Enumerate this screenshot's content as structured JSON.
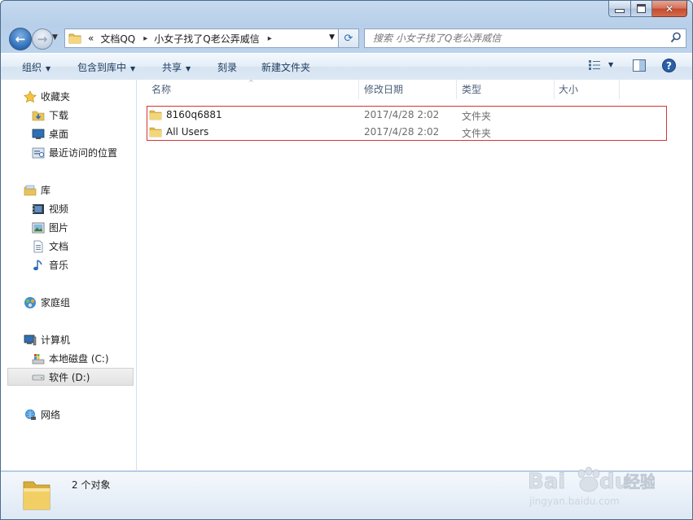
{
  "window": {
    "caption_buttons": {
      "close": "✕"
    }
  },
  "address": {
    "crumbs": [
      "«",
      "文档QQ",
      "小女子找了Q老公弄威信"
    ],
    "separator": "▸"
  },
  "search": {
    "placeholder": "搜索 小女子找了Q老公弄威信"
  },
  "toolbar": {
    "items": [
      {
        "label": "组织",
        "caret": "▼"
      },
      {
        "label": "包含到库中",
        "caret": "▼"
      },
      {
        "label": "共享",
        "caret": "▼"
      },
      {
        "label": "刻录"
      },
      {
        "label": "新建文件夹"
      }
    ]
  },
  "nav": {
    "favorites": {
      "label": "收藏夹",
      "items": [
        "下载",
        "桌面",
        "最近访问的位置"
      ]
    },
    "libraries": {
      "label": "库",
      "items": [
        "视频",
        "图片",
        "文档",
        "音乐"
      ]
    },
    "homegroup": {
      "label": "家庭组"
    },
    "computer": {
      "label": "计算机",
      "items": [
        "本地磁盘 (C:)",
        "软件 (D:)"
      ],
      "selected": "软件 (D:)"
    },
    "network": {
      "label": "网络"
    }
  },
  "columns": [
    "名称",
    "修改日期",
    "类型",
    "大小"
  ],
  "files": [
    {
      "name": "8160q6881",
      "modified": "2017/4/28 2:02",
      "type": "文件夹",
      "size": ""
    },
    {
      "name": "All Users",
      "modified": "2017/4/28 2:02",
      "type": "文件夹",
      "size": ""
    }
  ],
  "status": {
    "count_text": "2 个对象"
  },
  "watermark": {
    "brand_text": "Bai",
    "brand_text2": "du",
    "suffix": "经验",
    "url": "jingyan.baidu.com"
  },
  "colors": {
    "highlight_border": "#d53535",
    "accent": "#2b6cb6"
  },
  "icons": [
    "folder-icon",
    "star-icon",
    "download-folder-icon",
    "desktop-icon",
    "recent-places-icon",
    "library-icon",
    "video-icon",
    "picture-icon",
    "document-icon",
    "music-icon",
    "homegroup-icon",
    "computer-icon",
    "drive-c-icon",
    "drive-d-icon",
    "network-icon",
    "search-icon",
    "refresh-icon",
    "view-icon",
    "preview-pane-icon",
    "help-icon"
  ]
}
